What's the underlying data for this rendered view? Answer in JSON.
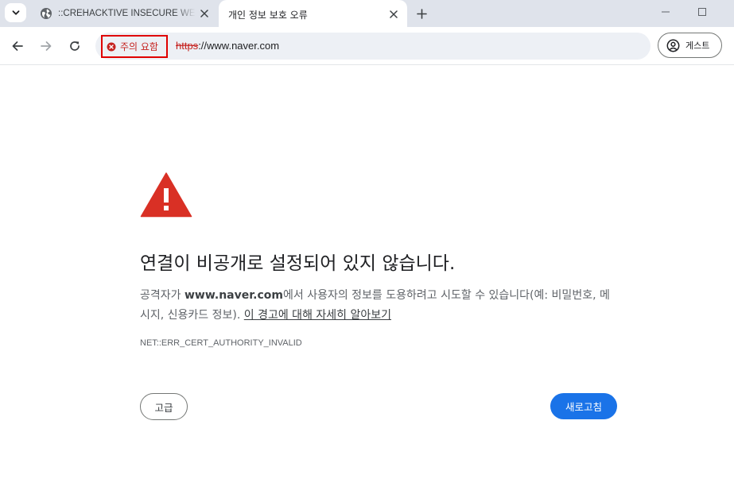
{
  "tabs": [
    {
      "title": "::CREHACKTIVE INSECURE WEBSITE",
      "active": false,
      "favicon": "globe-icon"
    },
    {
      "title": "개인 정보 보호 오류",
      "active": true,
      "favicon": "none"
    }
  ],
  "address_bar": {
    "security_chip_label": "주의 요함",
    "security_icon": "error-circle-icon",
    "url_scheme": "https",
    "url_rest": "://www.naver.com"
  },
  "profile": {
    "label": "게스트",
    "icon": "account-circle-icon"
  },
  "interstitial": {
    "heading": "연결이 비공개로 설정되어 있지 않습니다.",
    "desc_prefix": "공격자가 ",
    "desc_host": "www.naver.com",
    "desc_suffix": "에서 사용자의 정보를 도용하려고 시도할 수 있습니다(예: 비밀번호, 메시지, 신용카드 정보). ",
    "learn_more": "이 경고에 대해 자세히 알아보기",
    "error_code": "NET::ERR_CERT_AUTHORITY_INVALID",
    "advanced_button": "고급",
    "reload_button": "새로고침"
  },
  "colors": {
    "warning_red": "#d93025",
    "primary_blue": "#1a73e8",
    "highlight_box": "#e00000"
  }
}
